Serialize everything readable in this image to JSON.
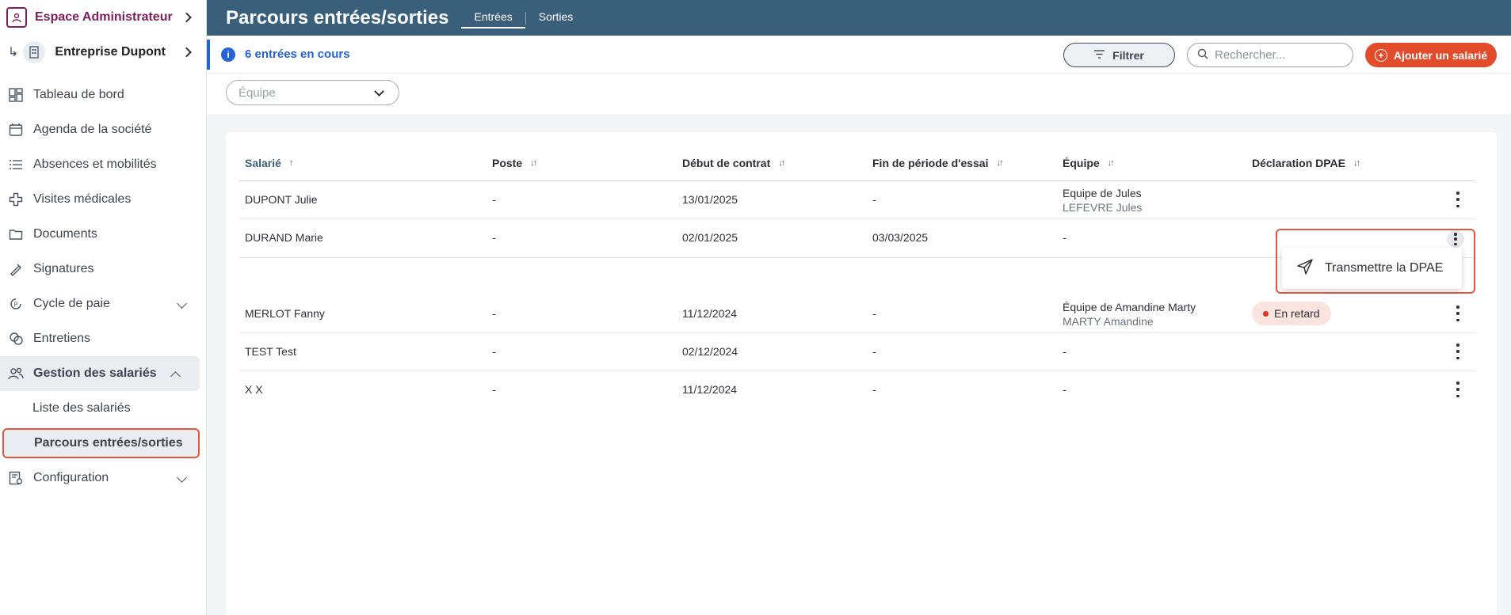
{
  "sidebar": {
    "space_title": "Espace Administrateur",
    "company_name": "Entreprise Dupont",
    "items": [
      {
        "label": "Tableau de bord",
        "icon": "dashboard-icon"
      },
      {
        "label": "Agenda de la société",
        "icon": "calendar-icon"
      },
      {
        "label": "Absences et mobilités",
        "icon": "list-icon"
      },
      {
        "label": "Visites médicales",
        "icon": "medical-cross-icon"
      },
      {
        "label": "Documents",
        "icon": "folder-icon"
      },
      {
        "label": "Signatures",
        "icon": "signature-icon"
      },
      {
        "label": "Cycle de paie",
        "icon": "payroll-cycle-icon"
      },
      {
        "label": "Entretiens",
        "icon": "chat-icon"
      },
      {
        "label": "Gestion des salariés",
        "icon": "users-icon"
      },
      {
        "label": "Configuration",
        "icon": "settings-icon"
      }
    ],
    "sub_items": [
      {
        "label": "Liste des salariés"
      },
      {
        "label": "Parcours entrées/sorties"
      }
    ]
  },
  "header": {
    "title": "Parcours entrées/sorties",
    "tabs": [
      {
        "label": "Entrées"
      },
      {
        "label": "Sorties"
      }
    ]
  },
  "infobar": {
    "text": "6 entrées en cours",
    "filter_label": "Filtrer",
    "search_placeholder": "Rechercher...",
    "add_label": "Ajouter un salarié"
  },
  "team_filter": {
    "placeholder": "Équipe"
  },
  "table": {
    "columns": [
      "Salarié",
      "Poste",
      "Début de contrat",
      "Fin de période d'essai",
      "Équipe",
      "Déclaration DPAE"
    ],
    "rows": [
      {
        "name": "DUPONT Julie",
        "poste": "-",
        "debut": "13/01/2025",
        "fin": "-",
        "equipe": "Equipe de Jules",
        "equipe_sub": "LEFEVRE Jules",
        "dpae": ""
      },
      {
        "name": "DURAND Marie",
        "poste": "-",
        "debut": "02/01/2025",
        "fin": "03/03/2025",
        "equipe": "-",
        "equipe_sub": "",
        "dpae": ""
      },
      {
        "name": "MERLOT Fanny",
        "poste": "-",
        "debut": "11/12/2024",
        "fin": "-",
        "equipe": "Équipe de Amandine Marty",
        "equipe_sub": "MARTY Amandine",
        "dpae": "En retard"
      },
      {
        "name": "TEST Test",
        "poste": "-",
        "debut": "02/12/2024",
        "fin": "-",
        "equipe": "-",
        "equipe_sub": "",
        "dpae": ""
      },
      {
        "name": "X X",
        "poste": "-",
        "debut": "11/12/2024",
        "fin": "-",
        "equipe": "-",
        "equipe_sub": "",
        "dpae": ""
      }
    ]
  },
  "popup": {
    "label": "Transmettre la DPAE"
  },
  "colors": {
    "brand": "#7b1f5e",
    "header_bg": "#3a5f7a",
    "accent": "#2561d8",
    "primary_action": "#e34c2b",
    "late_badge": "#fbe3e0"
  }
}
